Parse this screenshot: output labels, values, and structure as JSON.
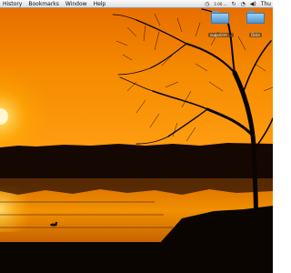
{
  "menubar": {
    "items": [
      "History",
      "Bookmarks",
      "Window",
      "Help"
    ],
    "status_text": "1:00 ...",
    "clock": "Thu"
  },
  "desktop_icons": [
    {
      "label": "sugarcrm ...",
      "icon": "folder-icon"
    },
    {
      "label": "Data",
      "icon": "folder-icon"
    }
  ],
  "icons": {
    "timer": "timer-icon",
    "sync": "sync-icon",
    "clock": "clock-icon",
    "volume": "volume-icon",
    "folder": "folder-icon"
  },
  "colors": {
    "sky_top": "#f07a00",
    "sky_bottom": "#ff9a00",
    "sun": "#fff2a8",
    "water": "#e88400",
    "silhouette": "#0b0502"
  }
}
